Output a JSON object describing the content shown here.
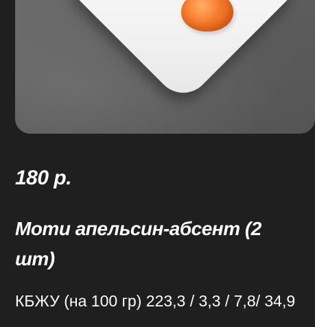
{
  "product": {
    "price": "180 р.",
    "title": "Моти апельсин-абсент (2 шт)",
    "nutrition": "КБЖУ (на 100 гр) 223,3 / 3,3 / 7,8/ 34,9"
  },
  "image": {
    "subject": "mochi-photo"
  },
  "colors": {
    "background": "#1f1f1f",
    "text": "#ffffff",
    "mochi": "#f5792a"
  }
}
